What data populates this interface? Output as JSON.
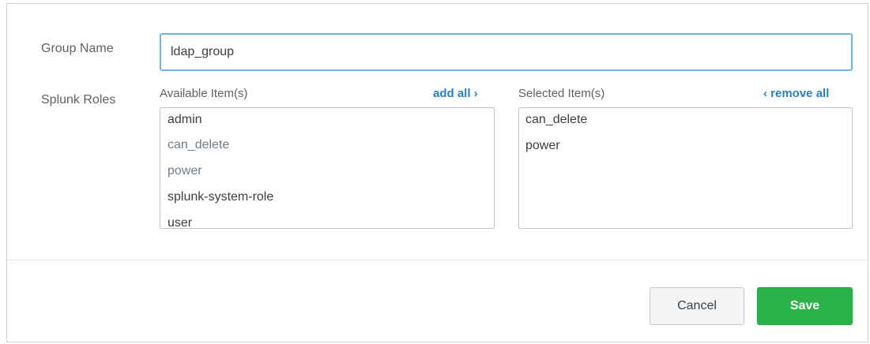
{
  "form": {
    "group_name_label": "Group Name",
    "group_name_value": "ldap_group",
    "roles_label": "Splunk Roles"
  },
  "available": {
    "header": "Available Item(s)",
    "add_all": "add all ›",
    "items": [
      "admin",
      "can_delete",
      "power",
      "splunk-system-role",
      "user"
    ]
  },
  "selected": {
    "header": "Selected Item(s)",
    "remove_all": "‹ remove all",
    "items": [
      "can_delete",
      "power"
    ]
  },
  "footer": {
    "cancel_label": "Cancel",
    "save_label": "Save"
  },
  "colors": {
    "link": "#2a7fc1",
    "save": "#2bb34a",
    "input_focus_border": "#6fb4e8"
  }
}
